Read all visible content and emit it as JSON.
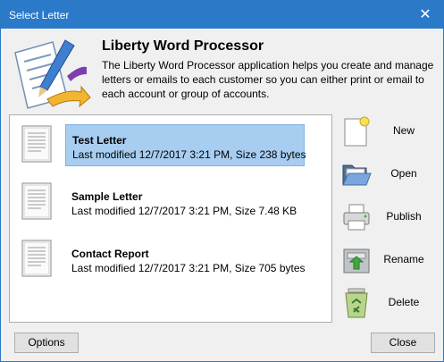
{
  "window": {
    "title": "Select Letter",
    "close_glyph": "✕"
  },
  "header": {
    "app_name": "Liberty Word Processor",
    "description": "The Liberty Word Processor application helps you create and manage letters or emails to each customer so you can either print or email to each account or group of accounts.",
    "logo_icon": "pen-and-paper-icon"
  },
  "letters": [
    {
      "name": "Test Letter",
      "meta": "Last modified 12/7/2017 3:21 PM, Size  238 bytes",
      "selected": true
    },
    {
      "name": "Sample Letter",
      "meta": "Last modified 12/7/2017 3:21 PM, Size  7.48 KB",
      "selected": false
    },
    {
      "name": "Contact Report",
      "meta": "Last modified 12/7/2017 3:21 PM, Size  705 bytes",
      "selected": false
    }
  ],
  "actions": [
    {
      "label": "New",
      "icon": "new-document-icon"
    },
    {
      "label": "Open",
      "icon": "folder-open-icon"
    },
    {
      "label": "Publish",
      "icon": "printer-icon"
    },
    {
      "label": "Rename",
      "icon": "rename-icon"
    },
    {
      "label": "Delete",
      "icon": "recycle-bin-icon"
    }
  ],
  "footer": {
    "options_label": "Options",
    "close_label": "Close"
  },
  "colors": {
    "titlebar": "#2b79c9",
    "selection": "#a7cdf0",
    "background": "#f0f0f0"
  }
}
